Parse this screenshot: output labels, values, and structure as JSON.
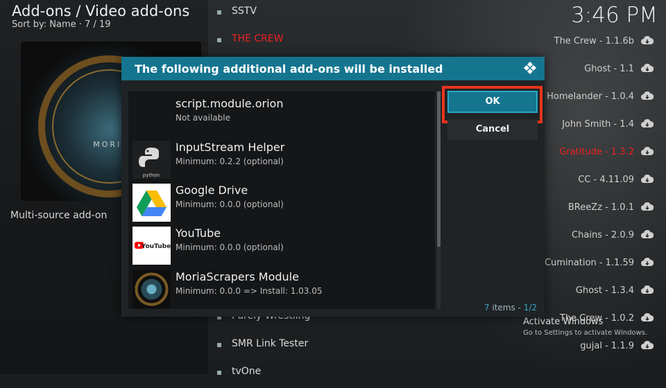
{
  "header": {
    "title": "Add-ons / Video add-ons",
    "subtitle": "Sort by: Name  ·  7 / 19",
    "clock": "3:46 PM"
  },
  "addon": {
    "poster_text": "MORIA",
    "description": "Multi-source add-on"
  },
  "middle_list": [
    {
      "label": "SSTV",
      "color": "#dddddd"
    },
    {
      "label": "THE CREW",
      "color": "#d44"
    },
    {
      "label": "",
      "color": "#dddddd"
    },
    {
      "label": "",
      "color": "#dddddd"
    },
    {
      "label": "",
      "color": "#dddddd"
    },
    {
      "label": "",
      "color": "#dddddd"
    },
    {
      "label": "",
      "color": "#dddddd"
    },
    {
      "label": "",
      "color": "#dddddd"
    },
    {
      "label": "",
      "color": "#dddddd"
    },
    {
      "label": "",
      "color": "#dddddd"
    },
    {
      "label": "",
      "color": "#dddddd"
    },
    {
      "label": "Purely Wrestling",
      "color": "#dddddd"
    },
    {
      "label": "SMR Link Tester",
      "color": "#dddddd"
    },
    {
      "label": "tvOne",
      "color": "#dddddd"
    }
  ],
  "right_list": [
    {
      "label": "The Crew - 1.1.6b",
      "red": false
    },
    {
      "label": "Ghost - 1.1",
      "red": false
    },
    {
      "label": "Homelander - 1.0.4",
      "red": false
    },
    {
      "label": "John Smith - 1.4",
      "red": false
    },
    {
      "label": "Gratitude - 1.3.2",
      "red": true
    },
    {
      "label": "CC - 4.11.09",
      "red": false
    },
    {
      "label": "BReeZz - 1.0.1",
      "red": false
    },
    {
      "label": "Chains - 2.0.9",
      "red": false
    },
    {
      "label": "Cumination - 1.1.59",
      "red": false
    },
    {
      "label": "Ghost - 1.3.4",
      "red": false
    },
    {
      "label": "The Crew - 1.0.2",
      "red": false
    },
    {
      "label": "gujal - 1.1.9",
      "red": false
    }
  ],
  "dialog": {
    "title": "The following additional add-ons will be installed",
    "ok_label": "OK",
    "cancel_label": "Cancel",
    "items_count": "7",
    "items_word": " items - ",
    "page": "1/2",
    "dependencies": [
      {
        "name": "script.module.orion",
        "version": "Not available",
        "icon": "none"
      },
      {
        "name": "InputStream Helper",
        "version": "Minimum: 0.2.2 (optional)",
        "icon": "python-icon"
      },
      {
        "name": "Google Drive",
        "version": "Minimum: 0.0.0 (optional)",
        "icon": "google-drive-icon"
      },
      {
        "name": "YouTube",
        "version": "Minimum: 0.0.0 (optional)",
        "icon": "youtube-icon"
      },
      {
        "name": "MoriaScrapers Module",
        "version": "Minimum: 0.0.0 => Install: 1.03.05",
        "icon": "moria-icon"
      }
    ]
  },
  "watermark": {
    "title": "Activate Windows",
    "subtitle": "Go to Settings to activate Windows."
  },
  "colors": {
    "accent": "#15758f",
    "highlight": "#e8341c"
  }
}
